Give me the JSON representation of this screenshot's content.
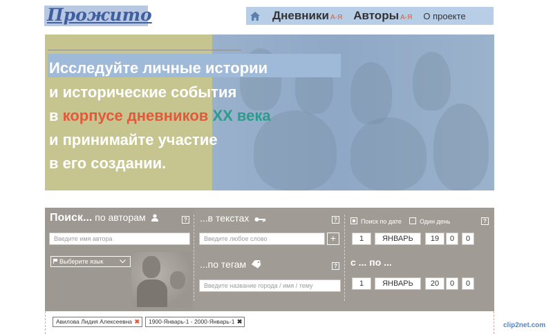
{
  "header": {
    "logo_text": "Прожито",
    "nav": {
      "home_icon": "home-icon",
      "diaries": {
        "label": "Дневники",
        "az": "А-Я"
      },
      "authors": {
        "label": "Авторы",
        "az": "А-Я"
      },
      "about": "О проекте"
    }
  },
  "hero": {
    "line1": "Исследуйте личные истории",
    "line2": "и исторические события",
    "line3_prefix": "в ",
    "line3_red": "корпусе дневников",
    "line3_teal": "XX века",
    "line4": "и принимайте участие",
    "line5": "в его создании."
  },
  "search": {
    "authors": {
      "title_bold": "Поиск...",
      "title_rest": "по авторам",
      "icon": "user-icon",
      "placeholder": "Введите имя автора",
      "help": "?"
    },
    "language": {
      "label": "Выберите язык",
      "icon": "flag-icon"
    },
    "texts": {
      "title": "...в текстах",
      "icon": "key-icon",
      "placeholder": "Введите любое слово",
      "add": "+",
      "help": "?"
    },
    "tags": {
      "title": "...по тегам",
      "icon": "tag-icon",
      "placeholder": "Введите название города / имя / тему",
      "help": "?"
    },
    "date": {
      "search_by_date_label": "Поиск по дате",
      "search_by_date_checked": true,
      "one_day_label": "Один день",
      "one_day_checked": false,
      "help": "?",
      "from": {
        "day": "1",
        "month": "ЯНВАРЬ",
        "year_a": "19",
        "year_b": "0",
        "year_c": "0"
      },
      "range_label": "с ... по ...",
      "to": {
        "day": "1",
        "month": "ЯНВАРЬ",
        "year_a": "20",
        "year_b": "0",
        "year_c": "0"
      }
    }
  },
  "active_filters": [
    {
      "label": "Авилова Лидия Алексеевна",
      "remove": "✖",
      "remove_color": "#e05a3a"
    },
    {
      "label": "1900-Январь-1 - 2000-Январь-1",
      "remove": "✖",
      "remove_color": "#333333"
    }
  ],
  "watermark": "clip2net.com",
  "colors": {
    "accent_red": "#e05a3a",
    "accent_teal": "#2e9a8a",
    "nav_bg": "#b8cde6",
    "search_bg": "#a19b95"
  }
}
